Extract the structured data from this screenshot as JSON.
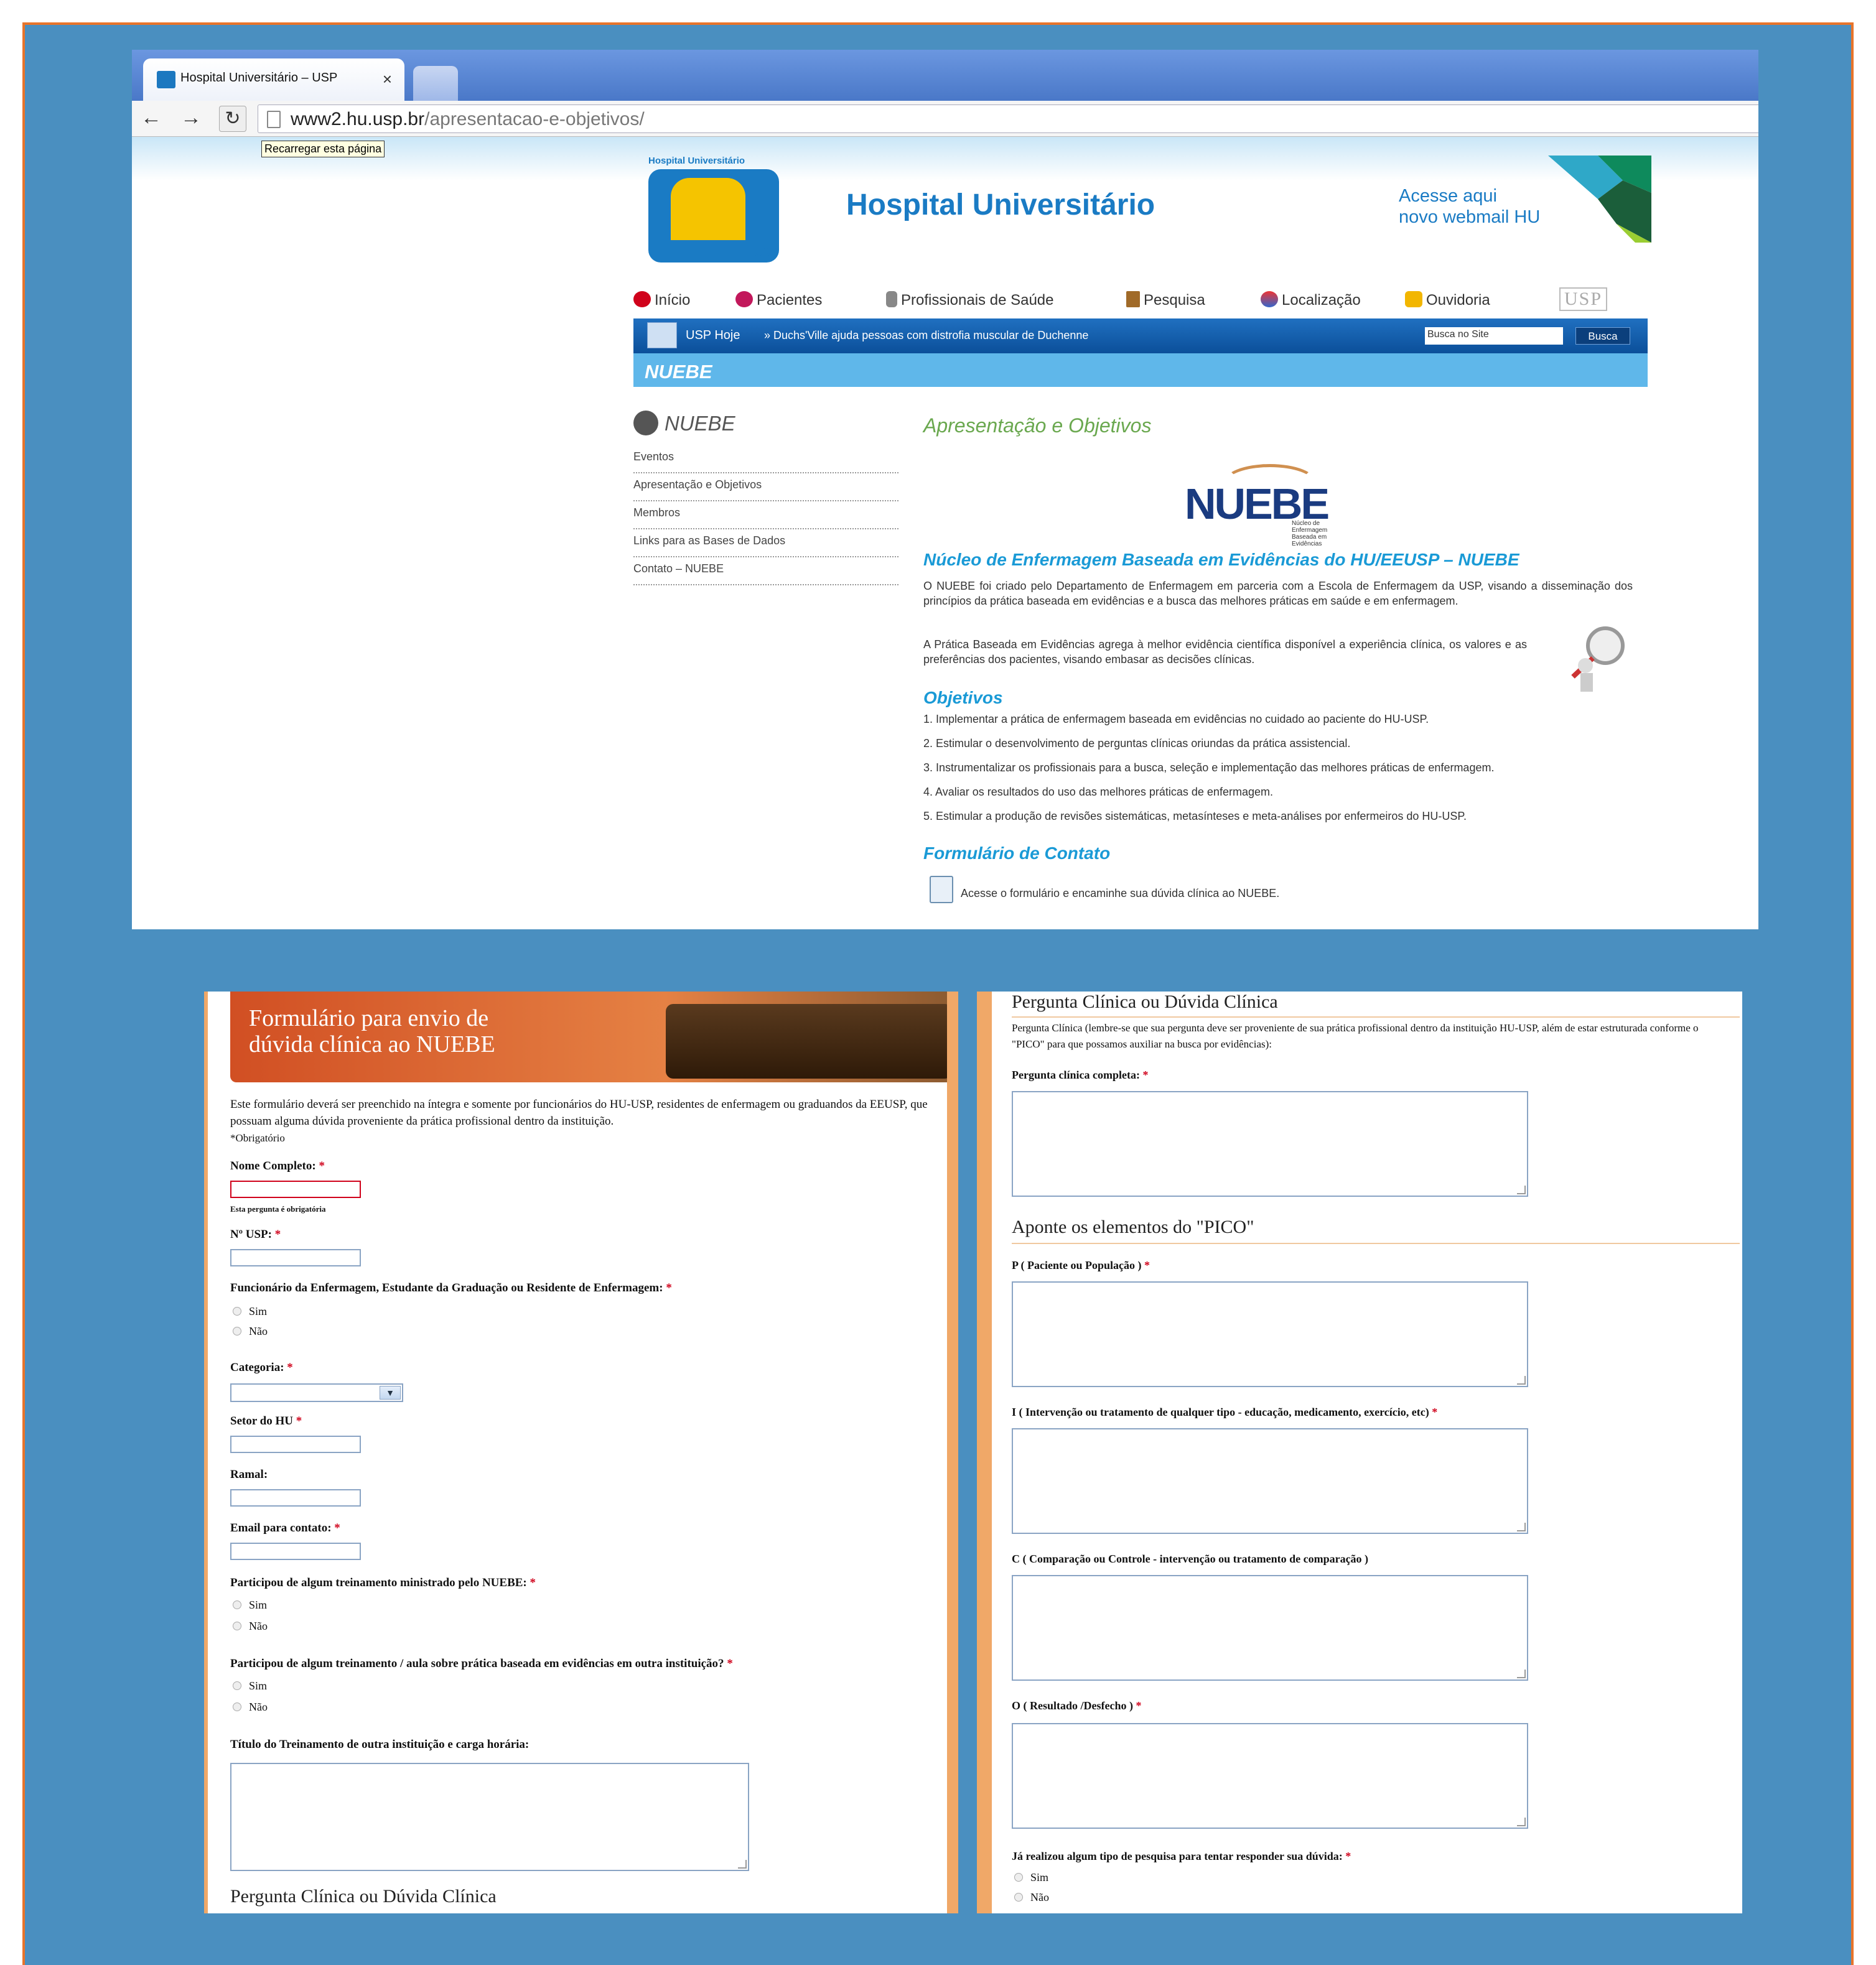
{
  "browser": {
    "tab_title": "Hospital Universitário – USP",
    "tab_close": "×",
    "url_host": "www2.hu.usp.br",
    "url_path": "/apresentacao-e-objetivos/",
    "tooltip": "Recarregar esta página"
  },
  "site": {
    "logo_caption": "Hospital Universitário",
    "logo_sub": "USP",
    "title": "Hospital Universitário",
    "webmail_line1": "Acesse aqui",
    "webmail_line2": "novo webmail HU",
    "menu": [
      "Início",
      "Pacientes",
      "Profissionais de Saúde",
      "Pesquisa",
      "Localização",
      "Ouvidoria"
    ],
    "usp_logo": "USP",
    "usp_hoje": "USP Hoje",
    "news": "» Duchs'Ville ajuda pessoas com distrofia muscular de Duchenne",
    "search_placeholder": "Busca no Site",
    "search_button": "Busca",
    "section_bar": "NUEBE"
  },
  "sidebar": {
    "title": "NUEBE",
    "links": [
      "Eventos",
      "Apresentação e Objetivos",
      "Membros",
      "Links para as Bases de Dados",
      "Contato – NUEBE"
    ]
  },
  "main": {
    "heading": "Apresentação e Objetivos",
    "logo_word": "NUEBE",
    "logo_sub": "Núcleo de Enfermagem Baseada em Evidências",
    "subheading": "Núcleo de Enfermagem Baseada em Evidências do HU/EEUSP – NUEBE",
    "para1": "O  NUEBE foi criado pelo Departamento de Enfermagem em parceria com a Escola de Enfermagem da USP, visando a disseminação dos princípios da prática baseada em evidências e a busca das melhores práticas em saúde e em enfermagem.",
    "para2": "A Prática Baseada em Evidências agrega à melhor evidência científica disponível a experiência clínica, os valores e as preferências dos pacientes, visando embasar as decisões clínicas.",
    "objetivos_heading": "Objetivos",
    "objetivos": [
      "1. Implementar a prática de enfermagem baseada em evidências no cuidado ao paciente do HU-USP.",
      "2. Estimular o desenvolvimento de perguntas clínicas oriundas da prática assistencial.",
      "3. Instrumentalizar os profissionais para a busca, seleção e implementação das melhores práticas de enfermagem.",
      "4. Avaliar os resultados do uso das melhores práticas de enfermagem.",
      "5.  Estimular a produção de revisões sistemáticas, metasínteses e meta-análises por enfermeiros do HU-USP."
    ],
    "form_heading": "Formulário de Contato",
    "form_link": "Acesse o formulário e encaminhe sua dúvida clínica ao NUEBE."
  },
  "formA": {
    "banner_line1": "Formulário para envio de",
    "banner_line2": "dúvida clínica ao NUEBE",
    "intro": "Este formulário deverá ser preenchido na íntegra e somente por funcionários do HU-USP, residentes de enfermagem ou graduandos da EEUSP, que possuam alguma dúvida proveniente da prática profissional dentro da instituição.",
    "required_note": "*Obrigatório",
    "nome_label": "Nome Completo:",
    "nome_error": "Esta pergunta é obrigatória",
    "nusp_label": "Nº USP:",
    "funcionario_label": "Funcionário da Enfermagem, Estudante da Graduação ou Residente de Enfermagem:",
    "sim": "Sim",
    "nao": "Não",
    "categoria_label": "Categoria:",
    "setor_label": "Setor do HU",
    "ramal_label": "Ramal:",
    "email_label": "Email para contato:",
    "treinamento_nuebe_label": "Participou de algum treinamento ministrado pelo NUEBE:",
    "treinamento_outra_label": "Participou de algum treinamento / aula sobre prática baseada em evidências em outra instituição?",
    "titulo_treinamento_label": "Título do Treinamento de outra instituição e carga horária:",
    "pergunta_section": "Pergunta Clínica ou Dúvida Clínica",
    "star": "*"
  },
  "formB": {
    "section_title": "Pergunta Clínica ou Dúvida Clínica",
    "section_desc": "Pergunta Clínica (lembre-se que sua pergunta deve ser proveniente de sua prática profissional dentro da instituição HU-USP, além de estar estruturada conforme o \"PICO\" para que possamos auxiliar na busca por evidências):",
    "pergunta_label": "Pergunta clínica completa:",
    "pico_title": "Aponte os elementos do \"PICO\"",
    "p_label": "P ( Paciente ou População )",
    "i_label": "I ( Intervenção ou tratamento de qualquer tipo - educação, medicamento, exercício, etc)",
    "c_label": "C ( Comparação ou Controle - intervenção ou tratamento de comparação )",
    "o_label": "O ( Resultado /Desfecho )",
    "pesquisa_label": "Já realizou algum tipo de pesquisa para tentar responder sua dúvida:",
    "sim": "Sim",
    "nao": "Não",
    "star": "*"
  }
}
